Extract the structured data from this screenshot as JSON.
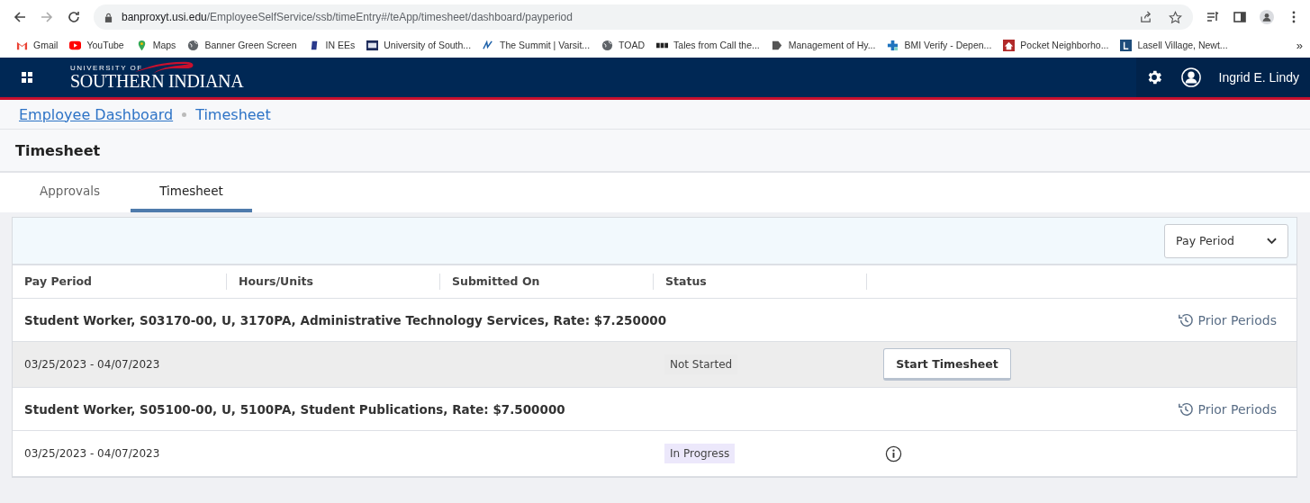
{
  "browser": {
    "url_host": "banproxyt.usi.edu",
    "url_path": "/EmployeeSelfService/ssb/timeEntry#/teApp/timesheet/dashboard/payperiod",
    "bookmarks": [
      {
        "label": "Gmail",
        "kind": "gmail"
      },
      {
        "label": "YouTube",
        "kind": "youtube"
      },
      {
        "label": "Maps",
        "kind": "maps"
      },
      {
        "label": "Banner Green Screen",
        "kind": "globe"
      },
      {
        "label": "IN EEs",
        "kind": "book"
      },
      {
        "label": "University of South...",
        "kind": "usi"
      },
      {
        "label": "The Summit | Varsit...",
        "kind": "swoosh"
      },
      {
        "label": "TOAD",
        "kind": "globe"
      },
      {
        "label": "Tales from Call the...",
        "kind": "bbc"
      },
      {
        "label": "Management of Hy...",
        "kind": "chevron"
      },
      {
        "label": "BMI Verify - Depen...",
        "kind": "cross"
      },
      {
        "label": "Pocket Neighborho...",
        "kind": "house"
      },
      {
        "label": "Lasell Village, Newt...",
        "kind": "letter"
      }
    ],
    "more": "»"
  },
  "header": {
    "logo_top": "UNIVERSITY OF",
    "logo_main": "SOUTHERN INDIANA",
    "user": "Ingrid E. Lindy"
  },
  "breadcrumb": [
    {
      "label": "Employee Dashboard",
      "link": true
    },
    {
      "label": "Timesheet",
      "link": false
    }
  ],
  "page_title": "Timesheet",
  "tabs": [
    {
      "label": "Approvals",
      "selected": false
    },
    {
      "label": "Timesheet",
      "selected": true
    }
  ],
  "filter": {
    "label": "Pay Period"
  },
  "table": {
    "columns": [
      "Pay Period",
      "Hours/Units",
      "Submitted On",
      "Status"
    ],
    "groups": [
      {
        "title": "Student Worker, S03170-00, U, 3170PA, Administrative Technology Services, Rate: $7.250000",
        "link": "Prior Periods",
        "period": "03/25/2023 - 04/07/2023",
        "status": {
          "label": "Not Started",
          "kind": "not_started"
        },
        "action": {
          "kind": "button",
          "label": "Start Timesheet"
        },
        "highlighted": true
      },
      {
        "title": "Student Worker, S05100-00, U, 5100PA, Student Publications, Rate: $7.500000",
        "link": "Prior Periods",
        "period": "03/25/2023 - 04/07/2023",
        "status": {
          "label": "In Progress",
          "kind": "in_progress"
        },
        "action": {
          "kind": "info"
        },
        "highlighted": false
      }
    ]
  }
}
